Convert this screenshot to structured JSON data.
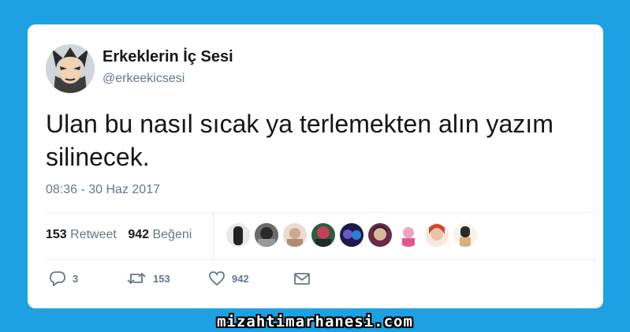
{
  "tweet": {
    "display_name": "Erkeklerin İç Sesi",
    "handle": "@erkeekicsesi",
    "text": "Ulan bu nasıl sıcak ya terlemekten alın yazım silinecek.",
    "timestamp": "08:36 - 30 Haz 2017",
    "stats": {
      "retweet_count": "153",
      "retweet_label": "Retweet",
      "like_count": "942",
      "like_label": "Beğeni"
    },
    "likers": [
      {
        "icon": "liker-avatar-1"
      },
      {
        "icon": "liker-avatar-2"
      },
      {
        "icon": "liker-avatar-3"
      },
      {
        "icon": "liker-avatar-4"
      },
      {
        "icon": "liker-avatar-5"
      },
      {
        "icon": "liker-avatar-6"
      },
      {
        "icon": "liker-avatar-7"
      },
      {
        "icon": "liker-avatar-8"
      },
      {
        "icon": "liker-avatar-9"
      }
    ],
    "actions": {
      "reply_count": "3",
      "retweet_count": "153",
      "like_count": "942"
    }
  },
  "watermark": "mizahtimarhanesi.com",
  "colors": {
    "background": "#1da1e2",
    "text_primary": "#14171a",
    "text_secondary": "#657786"
  }
}
